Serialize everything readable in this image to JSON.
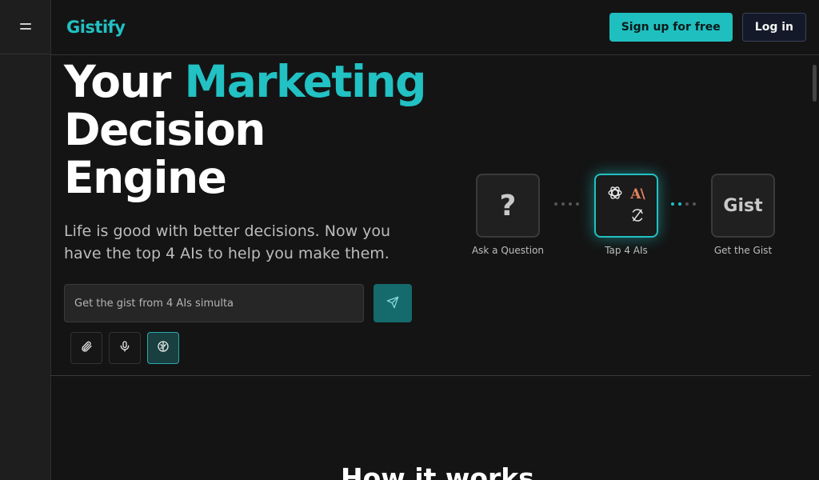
{
  "header": {
    "logo": "Gistify",
    "signup_label": "Sign up for free",
    "login_label": "Log in"
  },
  "hero": {
    "title_line1_a": "Your ",
    "title_line1_b": "Marketing",
    "title_line2": "Decision",
    "title_line3": "Engine",
    "subtitle": "Life is good with better decisions. Now you have the top 4 AIs to help you make them."
  },
  "prompt": {
    "placeholder": "Get the gist from 4 AIs simulta"
  },
  "flow": {
    "step1_symbol": "?",
    "step1_label": "Ask a Question",
    "step2_anthropic": "A\\",
    "step2_label": "Tap 4 AIs",
    "step3_symbol": "Gist",
    "step3_label": "Get the Gist"
  },
  "section": {
    "how_title": "How it works"
  },
  "colors": {
    "accent": "#22c1c3",
    "background": "#141414",
    "sidebar": "#1e1e1e",
    "anthropic": "#e0845b"
  },
  "icons": [
    "menu-icon",
    "send-icon",
    "paperclip-icon",
    "microphone-icon",
    "brain-icon",
    "openai-icon",
    "perplexity-icon"
  ]
}
